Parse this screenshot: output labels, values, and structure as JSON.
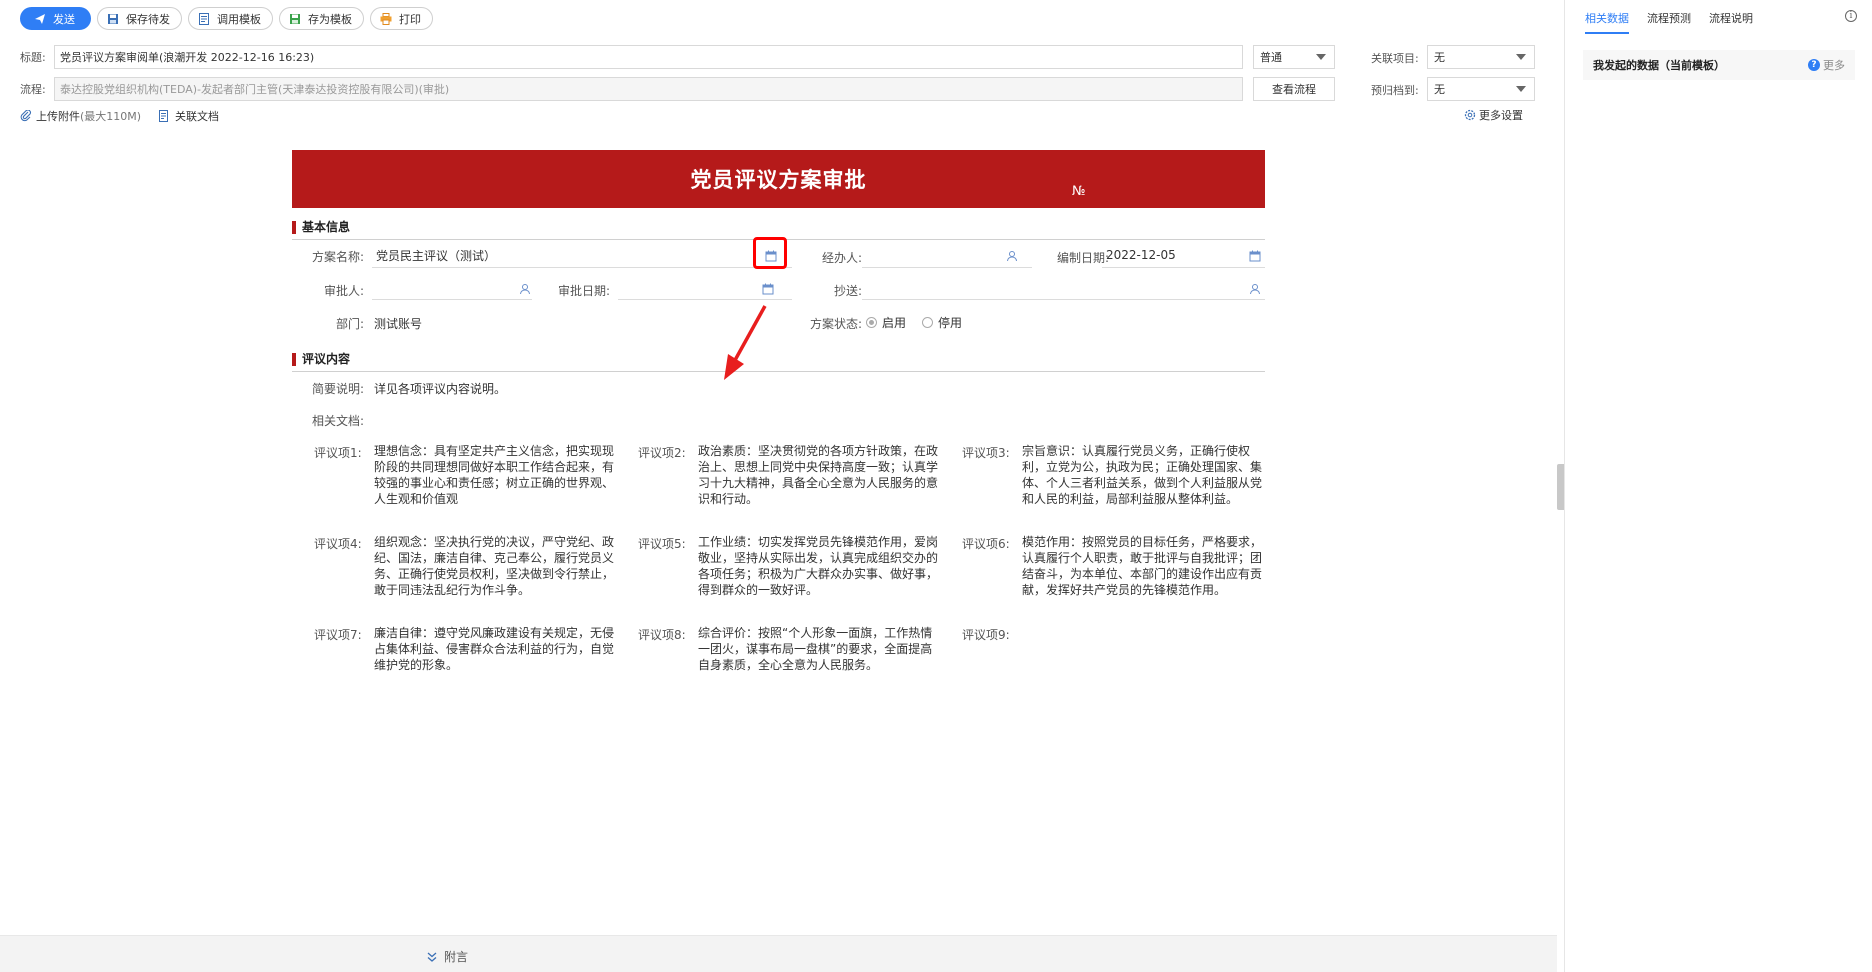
{
  "toolbar": {
    "send": "发送",
    "save_pending": "保存待发",
    "use_template": "调用模板",
    "save_template": "存为模板",
    "print": "打印"
  },
  "header": {
    "title_label": "标题:",
    "title_value": "党员评议方案审阅单(浪潮开发 2022-12-16 16:23)",
    "priority": "普通",
    "related_project_label": "关联项目:",
    "related_project_value": "无",
    "flow_label": "流程:",
    "flow_value": "泰达控股党组织机构(TEDA)-发起者部门主管(天津泰达投资控股有限公司)(审批)",
    "view_flow": "查看流程",
    "archive_label": "预归档到:",
    "archive_value": "无",
    "upload": "上传附件",
    "upload_limit": "(最大110M)",
    "related_doc": "关联文档",
    "more_settings": "更多设置"
  },
  "form": {
    "title": "党员评议方案审批",
    "no_label": "№",
    "basic_section": "基本信息",
    "plan_name_label": "方案名称:",
    "plan_name_value": "党员民主评议（测试）",
    "handler_label": "经办人:",
    "compile_date_label": "编制日期:",
    "compile_date_value": "2022-12-05",
    "approver_label": "审批人:",
    "approve_date_label": "审批日期:",
    "cc_label": "抄送:",
    "dept_label": "部门:",
    "dept_value": "测试账号",
    "status_label": "方案状态:",
    "status_enabled": "启用",
    "status_disabled": "停用",
    "content_section": "评议内容",
    "summary_label": "简要说明:",
    "summary_value": "详见各项评议内容说明。",
    "docs_label": "相关文档:",
    "items": [
      {
        "label": "评议项1:",
        "text": "理想信念：具有坚定共产主义信念，把实现现阶段的共同理想同做好本职工作结合起来，有较强的事业心和责任感；树立正确的世界观、人生观和价值观"
      },
      {
        "label": "评议项2:",
        "text": "政治素质：坚决贯彻党的各项方针政策，在政治上、思想上同党中央保持高度一致；认真学习十九大精神，具备全心全意为人民服务的意识和行动。"
      },
      {
        "label": "评议项3:",
        "text": "宗旨意识：认真履行党员义务，正确行使权利，立党为公，执政为民；正确处理国家、集体、个人三者利益关系，做到个人利益服从党和人民的利益，局部利益服从整体利益。"
      },
      {
        "label": "评议项4:",
        "text": "组织观念：坚决执行党的决议，严守党纪、政纪、国法，廉洁自律、克己奉公，履行党员义务、正确行使党员权利，坚决做到令行禁止，敢于同违法乱纪行为作斗争。"
      },
      {
        "label": "评议项5:",
        "text": "工作业绩：切实发挥党员先锋模范作用，爱岗敬业，坚持从实际出发，认真完成组织交办的各项任务；积极为广大群众办实事、做好事，得到群众的一致好评。"
      },
      {
        "label": "评议项6:",
        "text": "模范作用：按照党员的目标任务，严格要求，认真履行个人职责，敢于批评与自我批评；团结奋斗，为本单位、本部门的建设作出应有贡献，发挥好共产党员的先锋模范作用。"
      },
      {
        "label": "评议项7:",
        "text": "廉洁自律：遵守党风廉政建设有关规定，无侵占集体利益、侵害群众合法利益的行为，自觉维护党的形象。"
      },
      {
        "label": "评议项8:",
        "text": "综合评价：按照“个人形象一面旗，工作热情一团火，谋事布局一盘棋”的要求，全面提高自身素质，全心全意为人民服务。"
      },
      {
        "label": "评议项9:",
        "text": ""
      }
    ]
  },
  "footer": {
    "attach_note": "附言"
  },
  "right_panel": {
    "tabs": [
      "相关数据",
      "流程预测",
      "流程说明"
    ],
    "card_title": "我发起的数据（当前模板）",
    "more": "更多"
  },
  "colors": {
    "primary": "#2f7ef5",
    "banner": "#b51a1a",
    "highlight": "#ff0000"
  }
}
